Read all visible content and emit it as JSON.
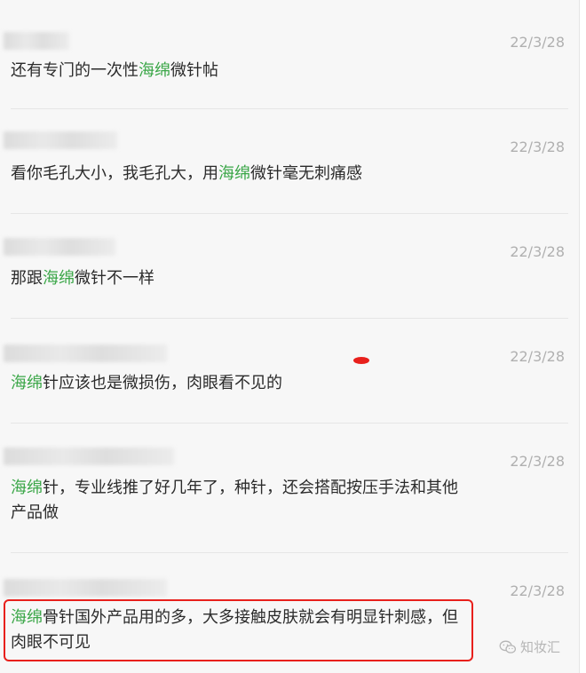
{
  "messages": [
    {
      "date": "22/3/28",
      "segments": [
        {
          "t": "还有专门的一次性"
        },
        {
          "t": "海绵",
          "hl": true
        },
        {
          "t": "微针帖"
        }
      ]
    },
    {
      "date": "22/3/28",
      "segments": [
        {
          "t": "看你毛孔大小，我毛孔大，用"
        },
        {
          "t": "海绵",
          "hl": true
        },
        {
          "t": "微针毫无刺痛感"
        }
      ]
    },
    {
      "date": "22/3/28",
      "segments": [
        {
          "t": "那跟"
        },
        {
          "t": "海绵",
          "hl": true
        },
        {
          "t": "微针不一样"
        }
      ]
    },
    {
      "date": "22/3/28",
      "segments": [
        {
          "t": "海绵",
          "hl": true
        },
        {
          "t": "针应该也是微损伤，肉眼看不见的"
        }
      ]
    },
    {
      "date": "22/3/28",
      "segments": [
        {
          "t": "海绵",
          "hl": true
        },
        {
          "t": "针，专业线推了好几年了，种针，还会搭配按压手法和其他产品做"
        }
      ]
    },
    {
      "date": "22/3/28",
      "segments": [
        {
          "t": "海绵",
          "hl": true
        },
        {
          "t": "骨针国外产品用的多，大多接触皮肤就会有明显针刺感，但肉眼不可见"
        }
      ]
    }
  ],
  "colors": {
    "highlight": "#3aa647",
    "annotation": "#e8201c"
  },
  "watermark": {
    "icon": "wechat-icon",
    "text": "知妆汇"
  }
}
